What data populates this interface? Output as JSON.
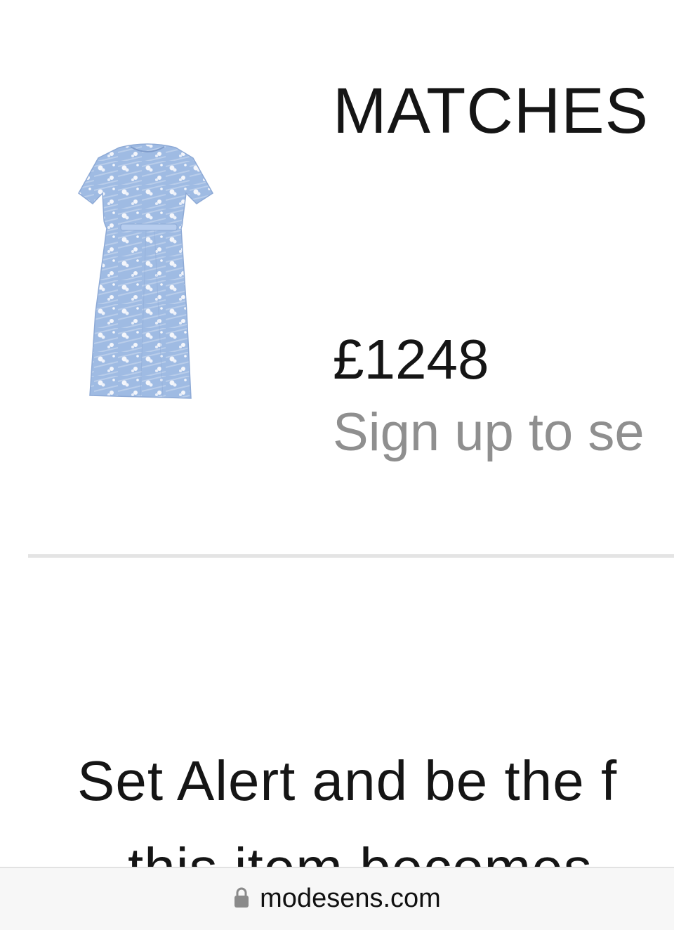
{
  "product": {
    "store_name": "MATCHES",
    "price": "£1248",
    "signup_text": "Sign up to se",
    "image_icon": "dress-image"
  },
  "alert": {
    "line1": "Set Alert and be the f",
    "line2": "this item becomes"
  },
  "browser": {
    "url": "modesens.com",
    "lock_icon": "lock-icon"
  },
  "colors": {
    "text": "#151515",
    "muted": "#8f8f8f",
    "divider": "#e4e4e4",
    "dress_blue": "#9db8e0"
  }
}
